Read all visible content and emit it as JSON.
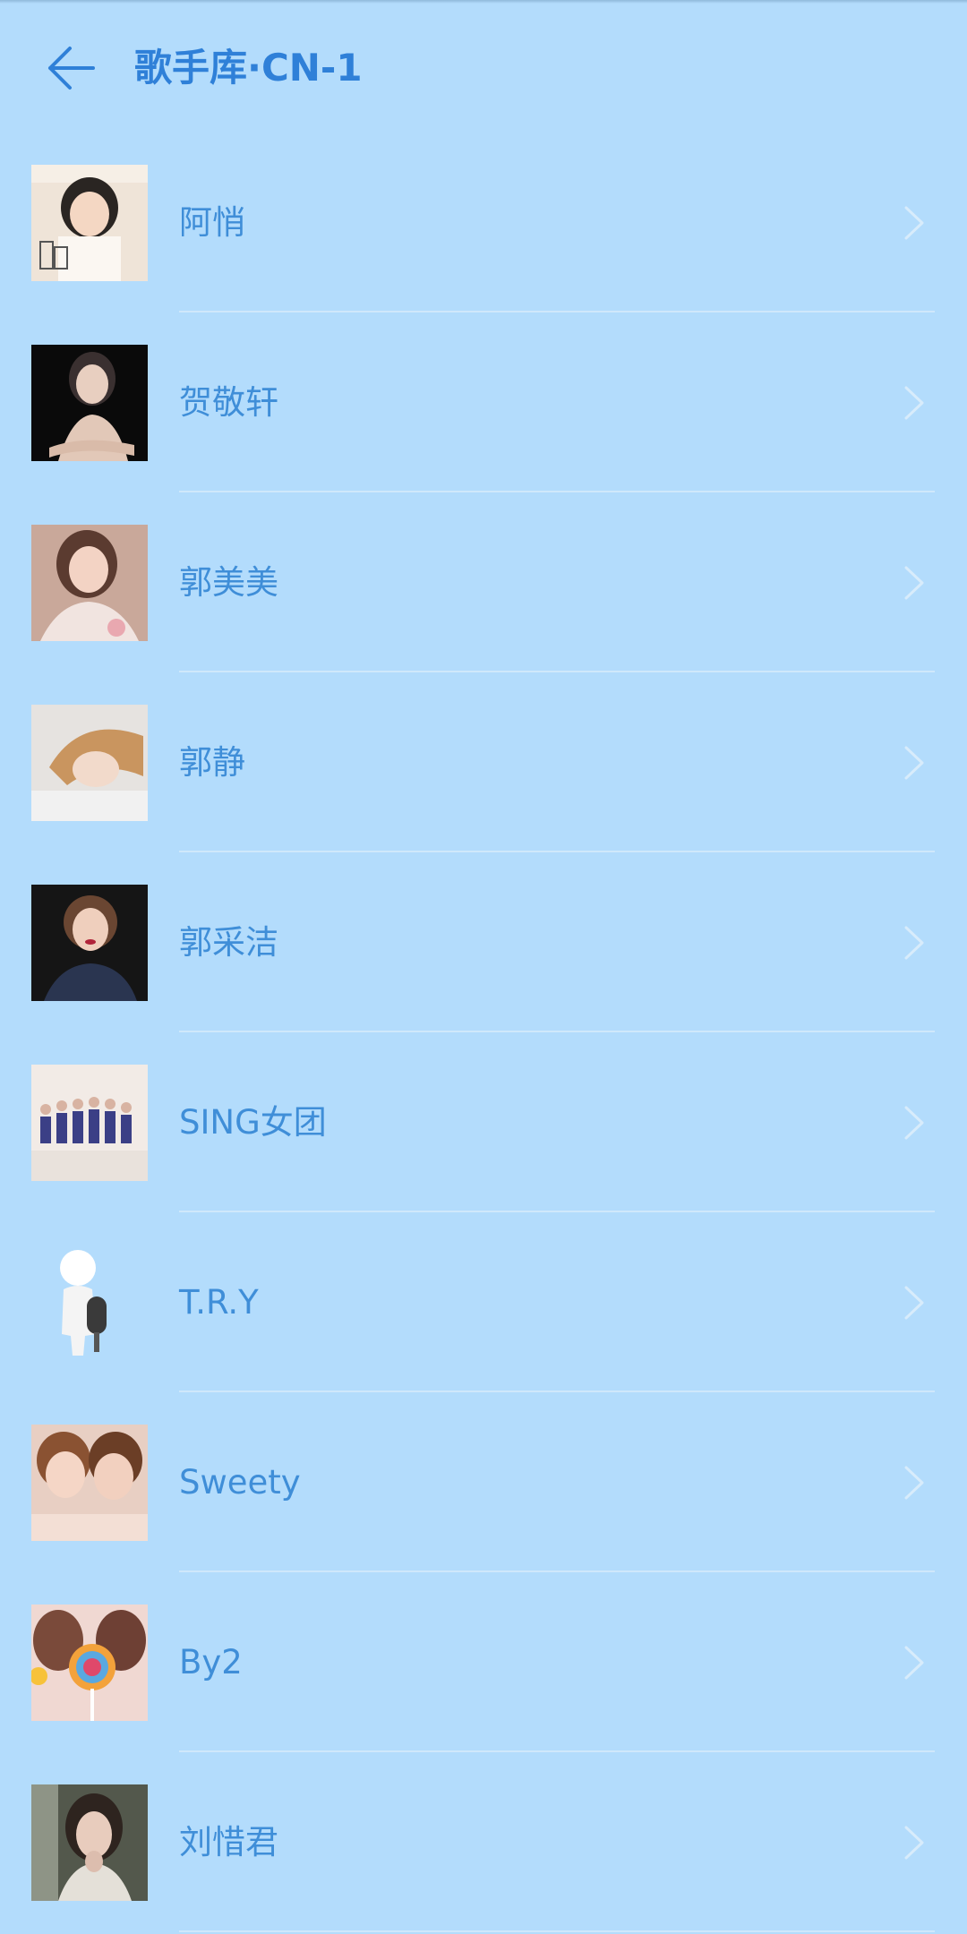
{
  "header": {
    "back_icon": "arrow-left-icon",
    "title": "歌手库·CN-1"
  },
  "colors": {
    "background": "#b3dcfc",
    "accent": "#2f80d8",
    "text": "#3f8ed8",
    "divider": "#cfe8fb",
    "chevron": "#d8ecfb"
  },
  "singers": [
    {
      "name": "阿悄",
      "icon": "chevron-right-icon"
    },
    {
      "name": "贺敬轩",
      "icon": "chevron-right-icon"
    },
    {
      "name": "郭美美",
      "icon": "chevron-right-icon"
    },
    {
      "name": "郭静",
      "icon": "chevron-right-icon"
    },
    {
      "name": "郭采洁",
      "icon": "chevron-right-icon"
    },
    {
      "name": "SING女团",
      "icon": "chevron-right-icon"
    },
    {
      "name": "T.R.Y",
      "icon": "chevron-right-icon"
    },
    {
      "name": "Sweety",
      "icon": "chevron-right-icon"
    },
    {
      "name": "By2",
      "icon": "chevron-right-icon"
    },
    {
      "name": "刘惜君",
      "icon": "chevron-right-icon"
    }
  ]
}
